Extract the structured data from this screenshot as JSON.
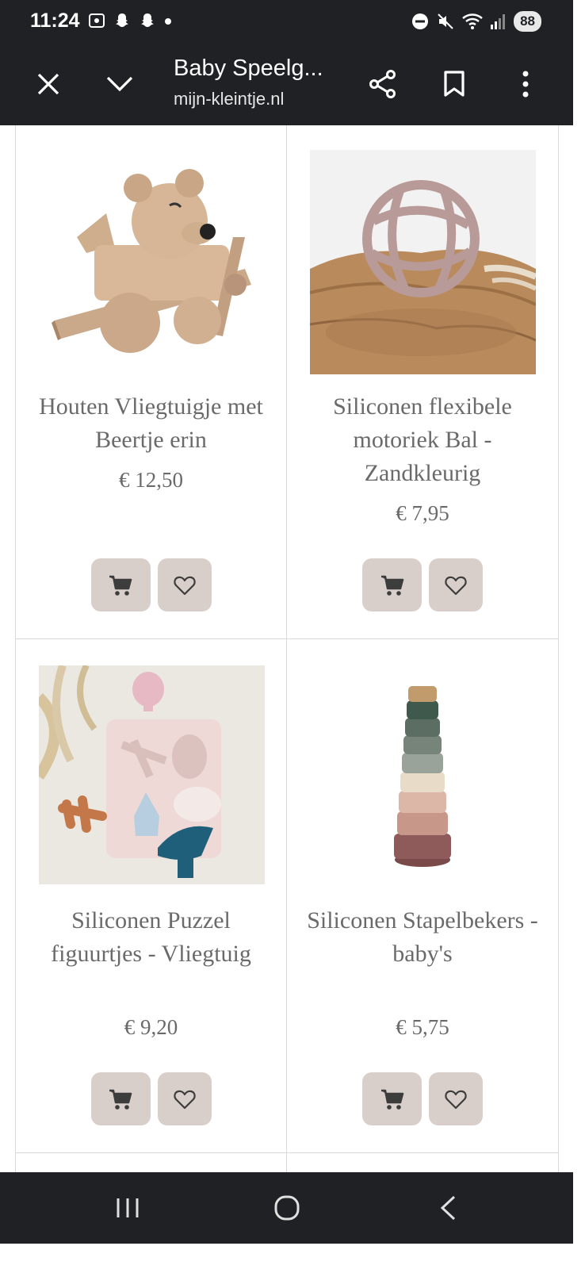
{
  "status": {
    "time": "11:24",
    "battery": "88"
  },
  "browser": {
    "title": "Baby Speelg...",
    "domain": "mijn-kleintje.nl"
  },
  "products": [
    {
      "name": "Houten Vliegtuigje met Beertje erin",
      "price": "€ 12,50"
    },
    {
      "name": "Siliconen flexibele motoriek Bal - Zandkleurig",
      "price": "€ 7,95"
    },
    {
      "name": "Siliconen Puzzel figuurtjes - Vliegtuig",
      "price": "€ 9,20"
    },
    {
      "name": "Siliconen Stapelbekers - baby's",
      "price": "€ 5,75"
    }
  ],
  "colors": {
    "button_bg": "#d9cfca",
    "text": "#6a6a6a",
    "chrome": "#202124"
  }
}
